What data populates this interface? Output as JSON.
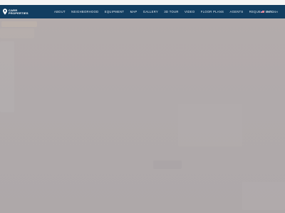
{
  "brand": {
    "logo_line1": "CARR",
    "logo_line2": "PROPERTIES",
    "logo_icon": "map-pin-icon"
  },
  "nav": {
    "items": [
      {
        "label": "ABOUT"
      },
      {
        "label": "NEIGHBORHOOD"
      },
      {
        "label": "EQUIPMENT"
      },
      {
        "label": "MAP"
      },
      {
        "label": "GALLERY"
      },
      {
        "label": "3D TOUR"
      },
      {
        "label": "VIDEO"
      },
      {
        "label": "FLOOR PLANS"
      },
      {
        "label": "AGENTS"
      },
      {
        "label": "REQUEST INFO"
      }
    ],
    "language": {
      "label": "ENGLISH",
      "icon": "us-flag-icon"
    }
  },
  "colors": {
    "nav_background": "#123e61",
    "nav_text": "#e9eef3",
    "content_background": "#b0aaab"
  }
}
